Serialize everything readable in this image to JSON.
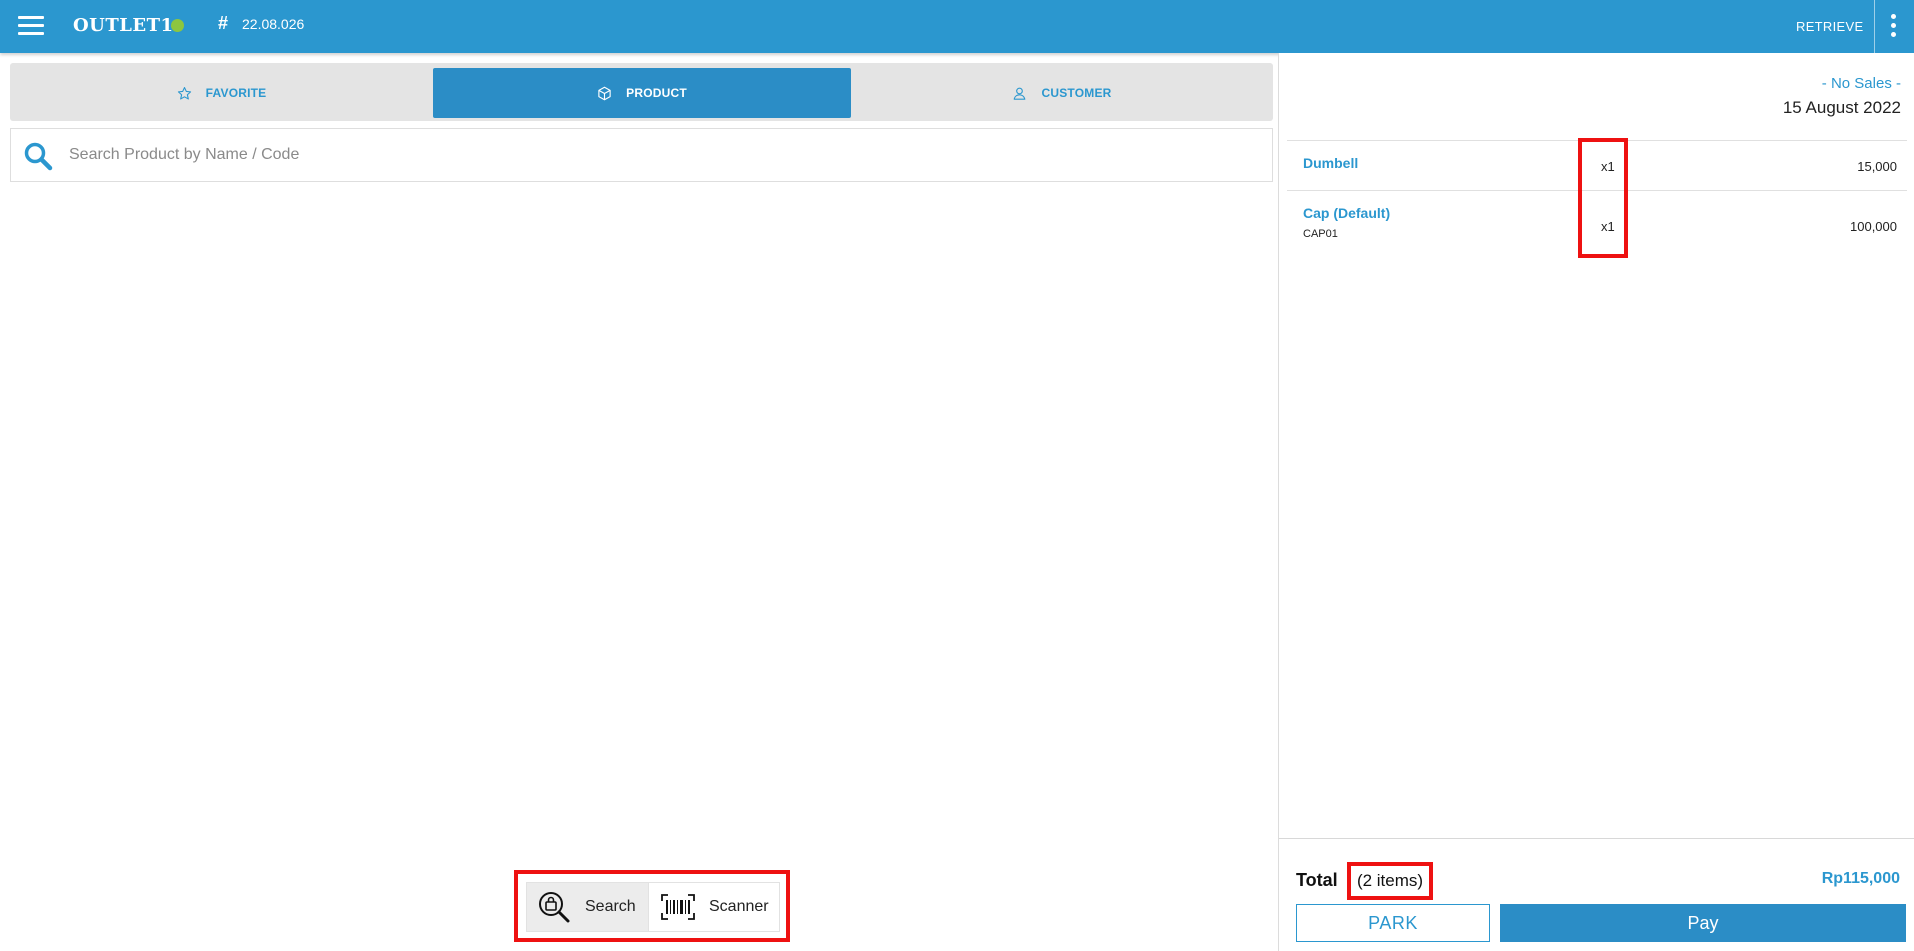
{
  "header": {
    "outlet_name": "OUTLET1",
    "status_color": "#8cc63f",
    "version": "22.08.026",
    "retrieve_label": "RETRIEVE"
  },
  "tabs": [
    {
      "label": "FAVORITE",
      "icon": "star-icon",
      "active": false
    },
    {
      "label": "PRODUCT",
      "icon": "cube-icon",
      "active": true
    },
    {
      "label": "CUSTOMER",
      "icon": "user-icon",
      "active": false
    }
  ],
  "search": {
    "placeholder": "Search Product by Name / Code",
    "value": ""
  },
  "mode_toggle": {
    "search_label": "Search",
    "scanner_label": "Scanner",
    "selected": "Search"
  },
  "sale": {
    "status": "- No Sales -",
    "date": "15 August 2022",
    "items": [
      {
        "name": "Dumbell",
        "code": "",
        "qty": "x1",
        "price": "15,000"
      },
      {
        "name": "Cap (Default)",
        "code": "CAP01",
        "qty": "x1",
        "price": "100,000"
      }
    ]
  },
  "footer": {
    "total_label": "Total",
    "items_count": "(2 items)",
    "total_amount": "Rp115,000",
    "park_label": "PARK",
    "pay_label": "Pay"
  },
  "colors": {
    "primary": "#2b97cf",
    "highlight": "#ee1111"
  }
}
